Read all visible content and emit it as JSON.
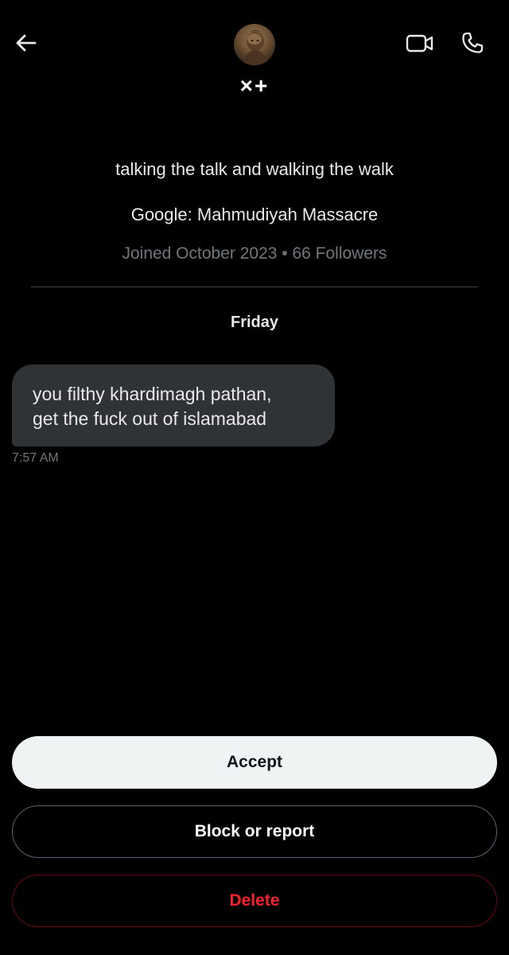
{
  "header": {
    "back_icon": "arrow-left-icon",
    "video_icon": "video-camera-icon",
    "call_icon": "phone-icon",
    "display_name": "×+"
  },
  "profile": {
    "bio_line_1": "talking the talk and walking the walk",
    "bio_line_2": "Google: Mahmudiyah Massacre",
    "meta": "Joined October 2023 • 66 Followers"
  },
  "conversation": {
    "day_label": "Friday",
    "messages": [
      {
        "text_line_1": "you filthy khardimagh pathan,",
        "text_line_2": "get the fuck out of islamabad",
        "time": "7:57 AM"
      }
    ]
  },
  "actions": {
    "accept_label": "Accept",
    "block_label": "Block or report",
    "delete_label": "Delete"
  },
  "colors": {
    "background": "#000000",
    "bubble": "#2f3336",
    "muted_text": "#71767b",
    "accept_bg": "#eff3f4",
    "delete_red": "#f4212e"
  }
}
